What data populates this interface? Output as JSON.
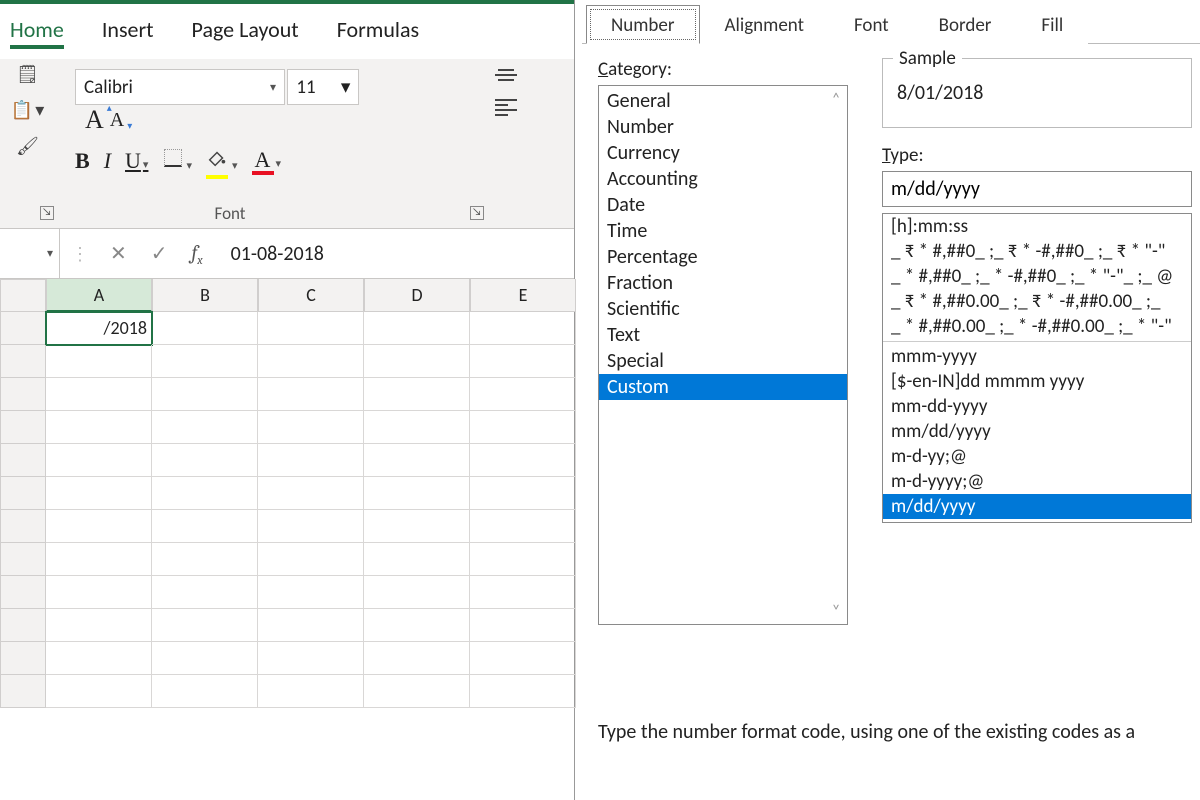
{
  "excel": {
    "tabs": [
      "Home",
      "Insert",
      "Page Layout",
      "Formulas"
    ],
    "active_tab": "Home",
    "font_name": "Calibri",
    "font_size": "11",
    "font_group_label": "Font",
    "formula_bar_value": "01-08-2018",
    "columns": [
      "A",
      "B",
      "C",
      "D",
      "E"
    ],
    "active_cell_value": "/2018"
  },
  "dialog": {
    "tabs": [
      "Number",
      "Alignment",
      "Font",
      "Border",
      "Fill"
    ],
    "active_tab": "Number",
    "category_label": "Category:",
    "categories": [
      "General",
      "Number",
      "Currency",
      "Accounting",
      "Date",
      "Time",
      "Percentage",
      "Fraction",
      "Scientific",
      "Text",
      "Special",
      "Custom"
    ],
    "selected_category": "Custom",
    "sample_label": "Sample",
    "sample_value": "8/01/2018",
    "type_label": "Type:",
    "type_value": "m/dd/yyyy",
    "type_list": [
      "[h]:mm:ss",
      "_ ₹ * #,##0_ ;_ ₹ * -#,##0_ ;_ ₹ * \"-\"",
      "_ * #,##0_ ;_ * -#,##0_ ;_ * \"-\"_ ;_ @",
      "_ ₹ * #,##0.00_ ;_ ₹ * -#,##0.00_ ;_",
      "_ * #,##0.00_ ;_ * -#,##0.00_ ;_ * \"-\"",
      "---",
      "mmm-yyyy",
      "[$-en-IN]dd mmmm yyyy",
      "mm-dd-yyyy",
      "mm/dd/yyyy",
      "m-d-yy;@",
      "m-d-yyyy;@",
      "m/dd/yyyy"
    ],
    "selected_type": "m/dd/yyyy",
    "help_text": "Type the number format code, using one of the existing codes as a"
  }
}
